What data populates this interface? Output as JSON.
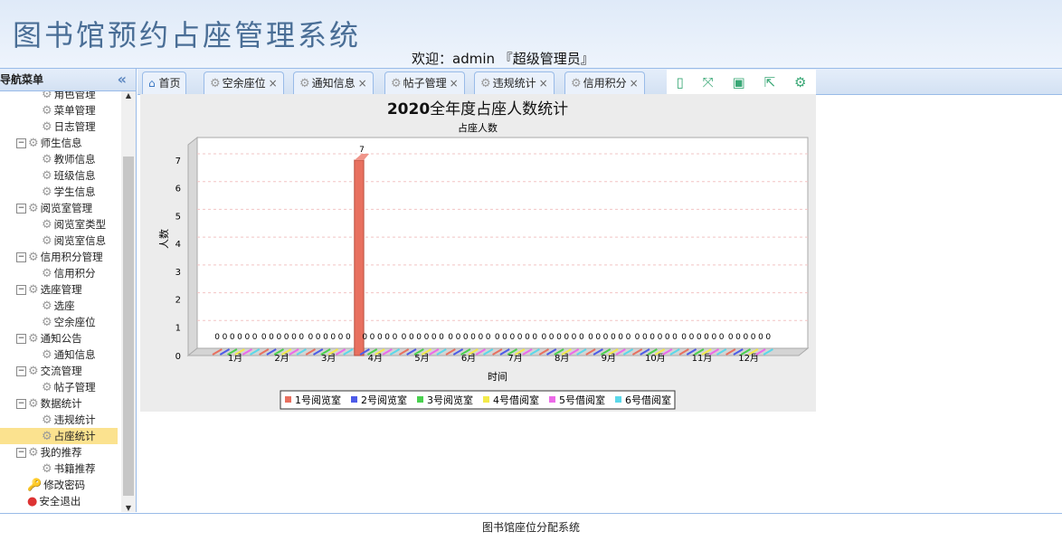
{
  "header": {
    "title": "图书馆预约占座管理系统",
    "welcome": "欢迎：admin 『超级管理员』"
  },
  "sidebar": {
    "title": "导航菜单",
    "collapse_icon": "double-chevron-left",
    "items": [
      {
        "label": "角色管理",
        "level": 2
      },
      {
        "label": "菜单管理",
        "level": 2
      },
      {
        "label": "日志管理",
        "level": 2
      },
      {
        "label": "师生信息",
        "level": 1
      },
      {
        "label": "教师信息",
        "level": 2
      },
      {
        "label": "班级信息",
        "level": 2
      },
      {
        "label": "学生信息",
        "level": 2
      },
      {
        "label": "阅览室管理",
        "level": 1
      },
      {
        "label": "阅览室类型",
        "level": 2
      },
      {
        "label": "阅览室信息",
        "level": 2
      },
      {
        "label": "信用积分管理",
        "level": 1
      },
      {
        "label": "信用积分",
        "level": 2
      },
      {
        "label": "选座管理",
        "level": 1
      },
      {
        "label": "选座",
        "level": 2
      },
      {
        "label": "空余座位",
        "level": 2
      },
      {
        "label": "通知公告",
        "level": 1
      },
      {
        "label": "通知信息",
        "level": 2
      },
      {
        "label": "交流管理",
        "level": 1
      },
      {
        "label": "帖子管理",
        "level": 2
      },
      {
        "label": "数据统计",
        "level": 1
      },
      {
        "label": "违规统计",
        "level": 2
      },
      {
        "label": "占座统计",
        "level": 2,
        "selected": true
      },
      {
        "label": "我的推荐",
        "level": 1
      },
      {
        "label": "书籍推荐",
        "level": 2
      },
      {
        "label": "修改密码",
        "level": 0
      },
      {
        "label": "安全退出",
        "level": 0
      }
    ]
  },
  "tabs": [
    {
      "label": "首页"
    },
    {
      "label": "空余座位",
      "close": "×"
    },
    {
      "label": "通知信息",
      "close": "×"
    },
    {
      "label": "帖子管理",
      "close": "×"
    },
    {
      "label": "违规统计",
      "close": "×"
    },
    {
      "label": "信用积分",
      "close": "×"
    }
  ],
  "toolbox": [
    "mobile-icon",
    "fullscreen-icon",
    "save-icon",
    "export-icon",
    "settings-icon"
  ],
  "footer": "图书馆座位分配系统",
  "chart_data": {
    "type": "bar",
    "title_num": "2020",
    "title": "全年度占座人数统计",
    "subtitle": "占座人数",
    "xlabel": "时间",
    "ylabel": "人数",
    "ylim": [
      0,
      7
    ],
    "categories": [
      "1月",
      "2月",
      "3月",
      "4月",
      "5月",
      "6月",
      "7月",
      "8月",
      "9月",
      "10月",
      "11月",
      "12月"
    ],
    "series": [
      {
        "name": "1号阅览室",
        "color": "#e8705f",
        "values": [
          0,
          0,
          0,
          7,
          0,
          0,
          0,
          0,
          0,
          0,
          0,
          0
        ]
      },
      {
        "name": "2号阅览室",
        "color": "#4d5be8",
        "values": [
          0,
          0,
          0,
          0,
          0,
          0,
          0,
          0,
          0,
          0,
          0,
          0
        ]
      },
      {
        "name": "3号阅览室",
        "color": "#49d14e",
        "values": [
          0,
          0,
          0,
          0,
          0,
          0,
          0,
          0,
          0,
          0,
          0,
          0
        ]
      },
      {
        "name": "4号借阅室",
        "color": "#f3ea4a",
        "values": [
          0,
          0,
          0,
          0,
          0,
          0,
          0,
          0,
          0,
          0,
          0,
          0
        ]
      },
      {
        "name": "5号借阅室",
        "color": "#ec6ae8",
        "values": [
          0,
          0,
          0,
          0,
          0,
          0,
          0,
          0,
          0,
          0,
          0,
          0
        ]
      },
      {
        "name": "6号借阅室",
        "color": "#5ad8ea",
        "values": [
          0,
          0,
          0,
          0,
          0,
          0,
          0,
          0,
          0,
          0,
          0,
          0
        ]
      }
    ],
    "legend": "bottom",
    "grid": true
  }
}
